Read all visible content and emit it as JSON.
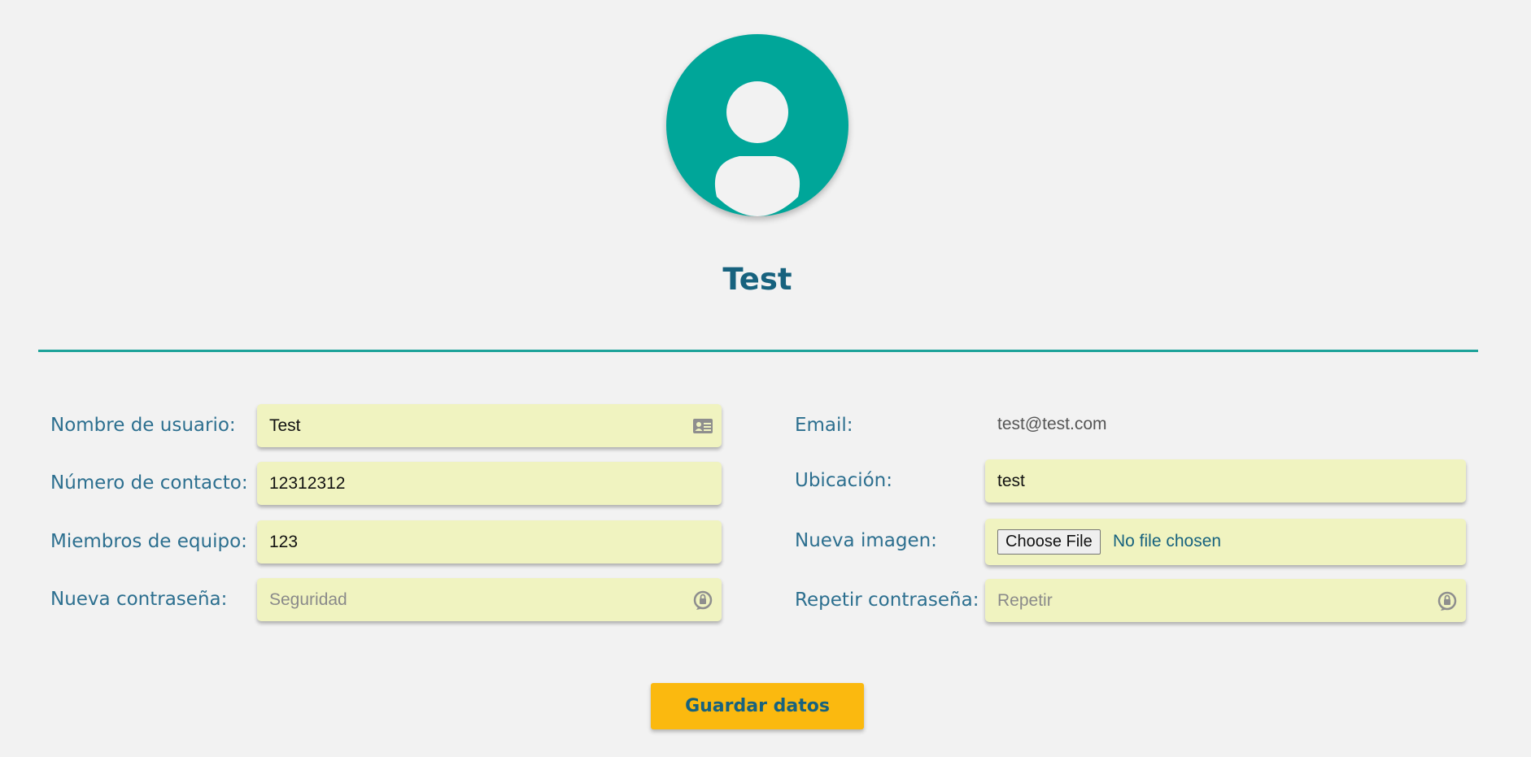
{
  "profile": {
    "name": "Test",
    "avatar_icon": "user-avatar-icon",
    "accent_color": "#00a699"
  },
  "form": {
    "left": {
      "username": {
        "label": "Nombre de usuario:",
        "value": "Test",
        "icon": "id-card-icon"
      },
      "contact": {
        "label": "Número de contacto:",
        "value": "12312312"
      },
      "team": {
        "label": "Miembros de equipo:",
        "value": "123"
      },
      "password": {
        "label": "Nueva contraseña:",
        "placeholder": "Seguridad",
        "icon": "lock-icon"
      }
    },
    "right": {
      "email": {
        "label": "Email:",
        "value": "test@test.com"
      },
      "location": {
        "label": "Ubicación:",
        "value": "test"
      },
      "image": {
        "label": "Nueva imagen:",
        "button_label": "Choose File",
        "status": "No file chosen"
      },
      "repeat_password": {
        "label": "Repetir contraseña:",
        "placeholder": "Repetir",
        "icon": "lock-icon"
      }
    }
  },
  "actions": {
    "save_label": "Guardar datos",
    "save_color": "#fbb90f"
  },
  "colors": {
    "text": "#2c6f8f",
    "title": "#17627e",
    "field_bg": "#f0f3c0",
    "divider": "#1ea39a"
  }
}
